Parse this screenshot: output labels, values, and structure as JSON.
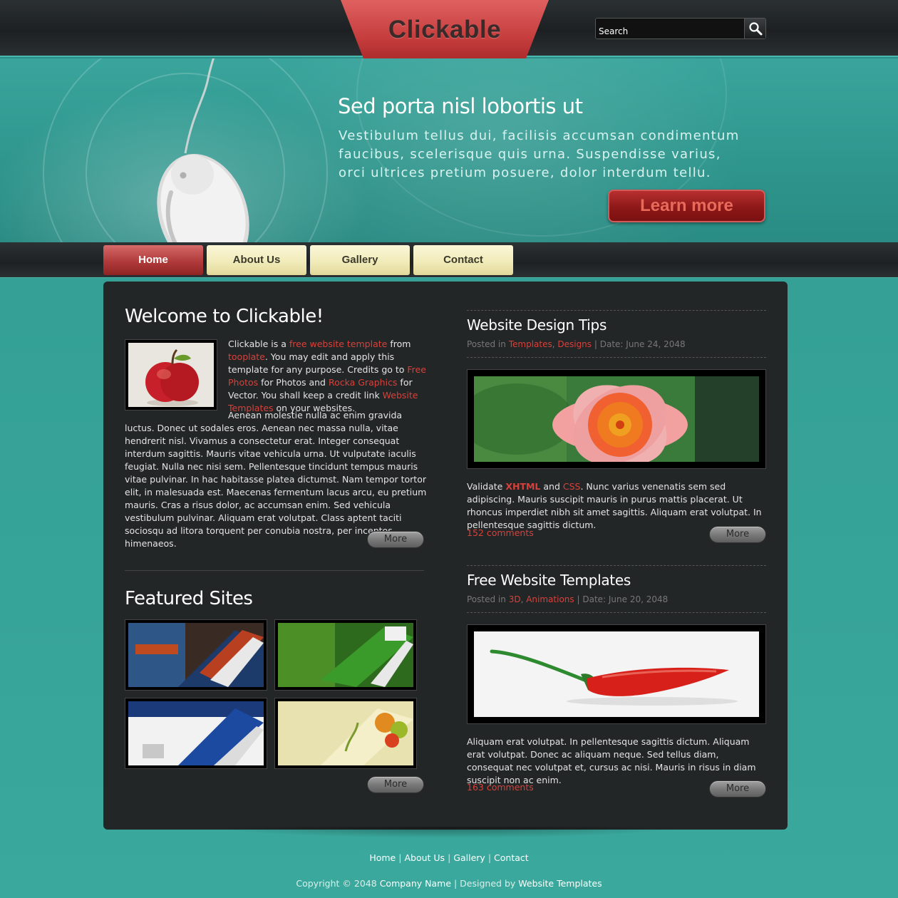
{
  "header": {
    "logo": "Clickable",
    "search_placeholder": "Search"
  },
  "hero": {
    "title": "Sed porta nisl lobortis ut",
    "text": "Vestibulum tellus dui, facilisis accumsan condimentum faucibus, scelerisque quis urna. Suspendisse varius, orci ultrices pretium posuere, dolor interdum tellu.",
    "button": "Learn more"
  },
  "nav": {
    "items": [
      "Home",
      "About Us",
      "Gallery",
      "Contact"
    ],
    "active": "Home"
  },
  "welcome": {
    "title": "Welcome to Clickable!",
    "p1_parts": [
      "Clickable is a ",
      "free website template",
      " from ",
      "tooplate",
      ". You may edit and apply this template for any purpose. Credits go to ",
      "Free Photos",
      " for Photos and ",
      "Rocka Graphics",
      " for Vector. You shall keep a credit link ",
      "Website Templates",
      " on your websites."
    ],
    "p2": "Aenean molestie nulla ac enim gravida luctus. Donec ut sodales eros. Aenean nec massa nulla, vitae hendrerit nisl. Vivamus a consectetur erat. Integer consequat interdum sagittis. Mauris vitae vehicula urna. Ut vulputate iaculis feugiat. Nulla nec nisi sem. Pellentesque tincidunt tempus mauris vitae pulvinar. In hac habitasse platea dictumst. Nam tempor tortor elit, in malesuada est. Maecenas fermentum lacus arcu, eu pretium mauris. Cras a risus dolor, ac accumsan enim. Sed vehicula vestibulum pulvinar. Aliquam erat volutpat. Class aptent taciti sociosqu ad litora torquent per conubia nostra, per inceptos himenaeos.",
    "more": "More"
  },
  "featured": {
    "title": "Featured Sites",
    "more": "More"
  },
  "posts": [
    {
      "title": "Website Design Tips",
      "posted_in": "Posted in",
      "cat1": "Templates",
      "cat2": "Designs",
      "date": "Date: June 24, 2048",
      "text_parts": [
        "Validate ",
        "XHTML",
        " and ",
        "CSS",
        ". Nunc varius venenatis sem sed adipiscing. Mauris suscipit mauris in purus mattis placerat. Ut rhoncus imperdiet nibh sit amet sagittis. Aliquam erat volutpat. In pellentesque sagittis dictum."
      ],
      "comments": "152 comments",
      "more": "More"
    },
    {
      "title": "Free Website Templates",
      "posted_in": "Posted in",
      "cat1": "3D",
      "cat2": "Animations",
      "date": "Date: June 20, 2048",
      "text": "Aliquam erat volutpat. In pellentesque sagittis dictum. Aliquam erat volutpat. Donec ac aliquam neque. Sed tellus diam, consequat nec volutpat et, cursus ac nisi. Mauris in risus in diam suscipit non ac enim.",
      "comments": "163 comments",
      "more": "More"
    }
  ],
  "footer": {
    "links": [
      "Home",
      "About Us",
      "Gallery",
      "Contact"
    ],
    "copyright_prefix": "Copyright © 2048",
    "company": "Company Name",
    "designed_by": "| Designed by",
    "designer": "Website Templates"
  },
  "colors": {
    "accent_red": "#d8403a",
    "teal_bg": "#34a096",
    "panel": "#232627"
  }
}
